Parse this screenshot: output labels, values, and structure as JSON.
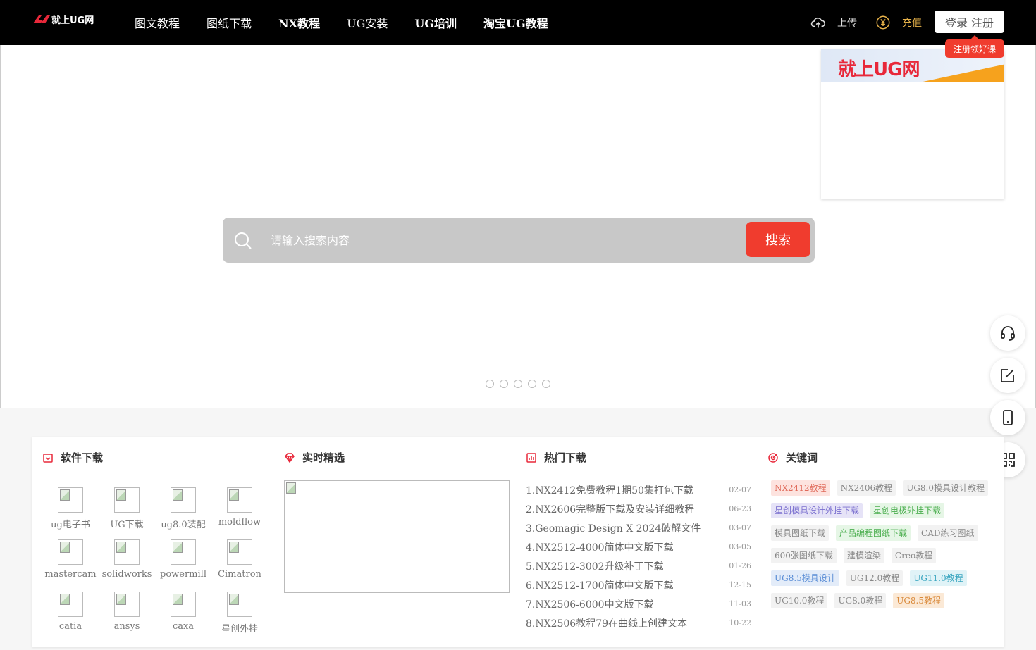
{
  "header": {
    "logo_text": "就上UG网",
    "nav": [
      {
        "label": "图文教程",
        "bold": false
      },
      {
        "label": "图纸下载",
        "bold": false
      },
      {
        "label": "NX教程",
        "bold": true
      },
      {
        "label": "UG安装",
        "bold": false
      },
      {
        "label": "UG培训",
        "bold": true
      },
      {
        "label": "淘宝UG教程",
        "bold": true
      }
    ],
    "upload_label": "上传",
    "recharge_label": "充值",
    "login_label": "登录 注册",
    "register_tip": "注册领好课",
    "recharge_color": "#e8b34a"
  },
  "search": {
    "placeholder": "请输入搜索内容",
    "button_label": "搜索",
    "button_color": "#f03c2e"
  },
  "carousel": {
    "slide_count": 5
  },
  "promo": {
    "text": "就上UG网"
  },
  "panel": {
    "software": {
      "title": "软件下载",
      "items": [
        "ug电子书",
        "UG下载",
        "ug8.0装配",
        "moldflow",
        "mastercam",
        "solidworks",
        "powermill",
        "Cimatron",
        "catia",
        "ansys",
        "caxa",
        "星创外挂"
      ]
    },
    "picks": {
      "title": "实时精选"
    },
    "hot": {
      "title": "热门下载",
      "items": [
        {
          "title": "1.NX2412免费教程1期50集打包下载",
          "date": "02-07"
        },
        {
          "title": "2.NX2606完整版下载及安装详细教程",
          "date": "06-23"
        },
        {
          "title": "3.Geomagic Design X 2024破解文件",
          "date": "03-07"
        },
        {
          "title": "4.NX2512-4000简体中文版下载",
          "date": "03-05"
        },
        {
          "title": "5.NX2512-3002升级补丁下载",
          "date": "01-26"
        },
        {
          "title": "6.NX2512-1700简体中文版下载",
          "date": "12-15"
        },
        {
          "title": "7.NX2506-6000中文版下载",
          "date": "11-03"
        },
        {
          "title": "8.NX2506教程79在曲线上创建文本",
          "date": "10-22"
        }
      ]
    },
    "keywords": {
      "title": "关键词",
      "rows": [
        [
          {
            "text": "NX2412教程",
            "bg": "#fde3df",
            "fg": "#e06a5a"
          },
          {
            "text": "NX2406教程",
            "bg": "#f2f2f2",
            "fg": "#888"
          },
          {
            "text": "UG8.0模具设计教程",
            "bg": "#f2f2f2",
            "fg": "#888"
          }
        ],
        [
          {
            "text": "星创模具设计外挂下载",
            "bg": "#e6e3f7",
            "fg": "#7a6fcf"
          },
          {
            "text": "星创电极外挂下载",
            "bg": "#e6f6e6",
            "fg": "#4caf50"
          }
        ],
        [
          {
            "text": "模具图纸下载",
            "bg": "#f2f2f2",
            "fg": "#888"
          },
          {
            "text": "产品编程图纸下载",
            "bg": "#e6f6e6",
            "fg": "#4caf50"
          },
          {
            "text": "CAD练习图纸",
            "bg": "#f2f2f2",
            "fg": "#888"
          }
        ],
        [
          {
            "text": "600张图纸下载",
            "bg": "#f2f2f2",
            "fg": "#888"
          },
          {
            "text": "建模渲染",
            "bg": "#f2f2f2",
            "fg": "#888"
          },
          {
            "text": "Creo教程",
            "bg": "#f2f2f2",
            "fg": "#888"
          }
        ],
        [
          {
            "text": "UG8.5模具设计",
            "bg": "#e3ecf9",
            "fg": "#5b8ed6"
          },
          {
            "text": "UG12.0教程",
            "bg": "#f2f2f2",
            "fg": "#888"
          },
          {
            "text": "UG11.0教程",
            "bg": "#e0f3f7",
            "fg": "#3aa6c0"
          }
        ],
        [
          {
            "text": "UG10.0教程",
            "bg": "#f2f2f2",
            "fg": "#888"
          },
          {
            "text": "UG8.0教程",
            "bg": "#f2f2f2",
            "fg": "#888"
          },
          {
            "text": "UG8.5教程",
            "bg": "#fbe9d6",
            "fg": "#d9893a"
          }
        ]
      ]
    }
  }
}
